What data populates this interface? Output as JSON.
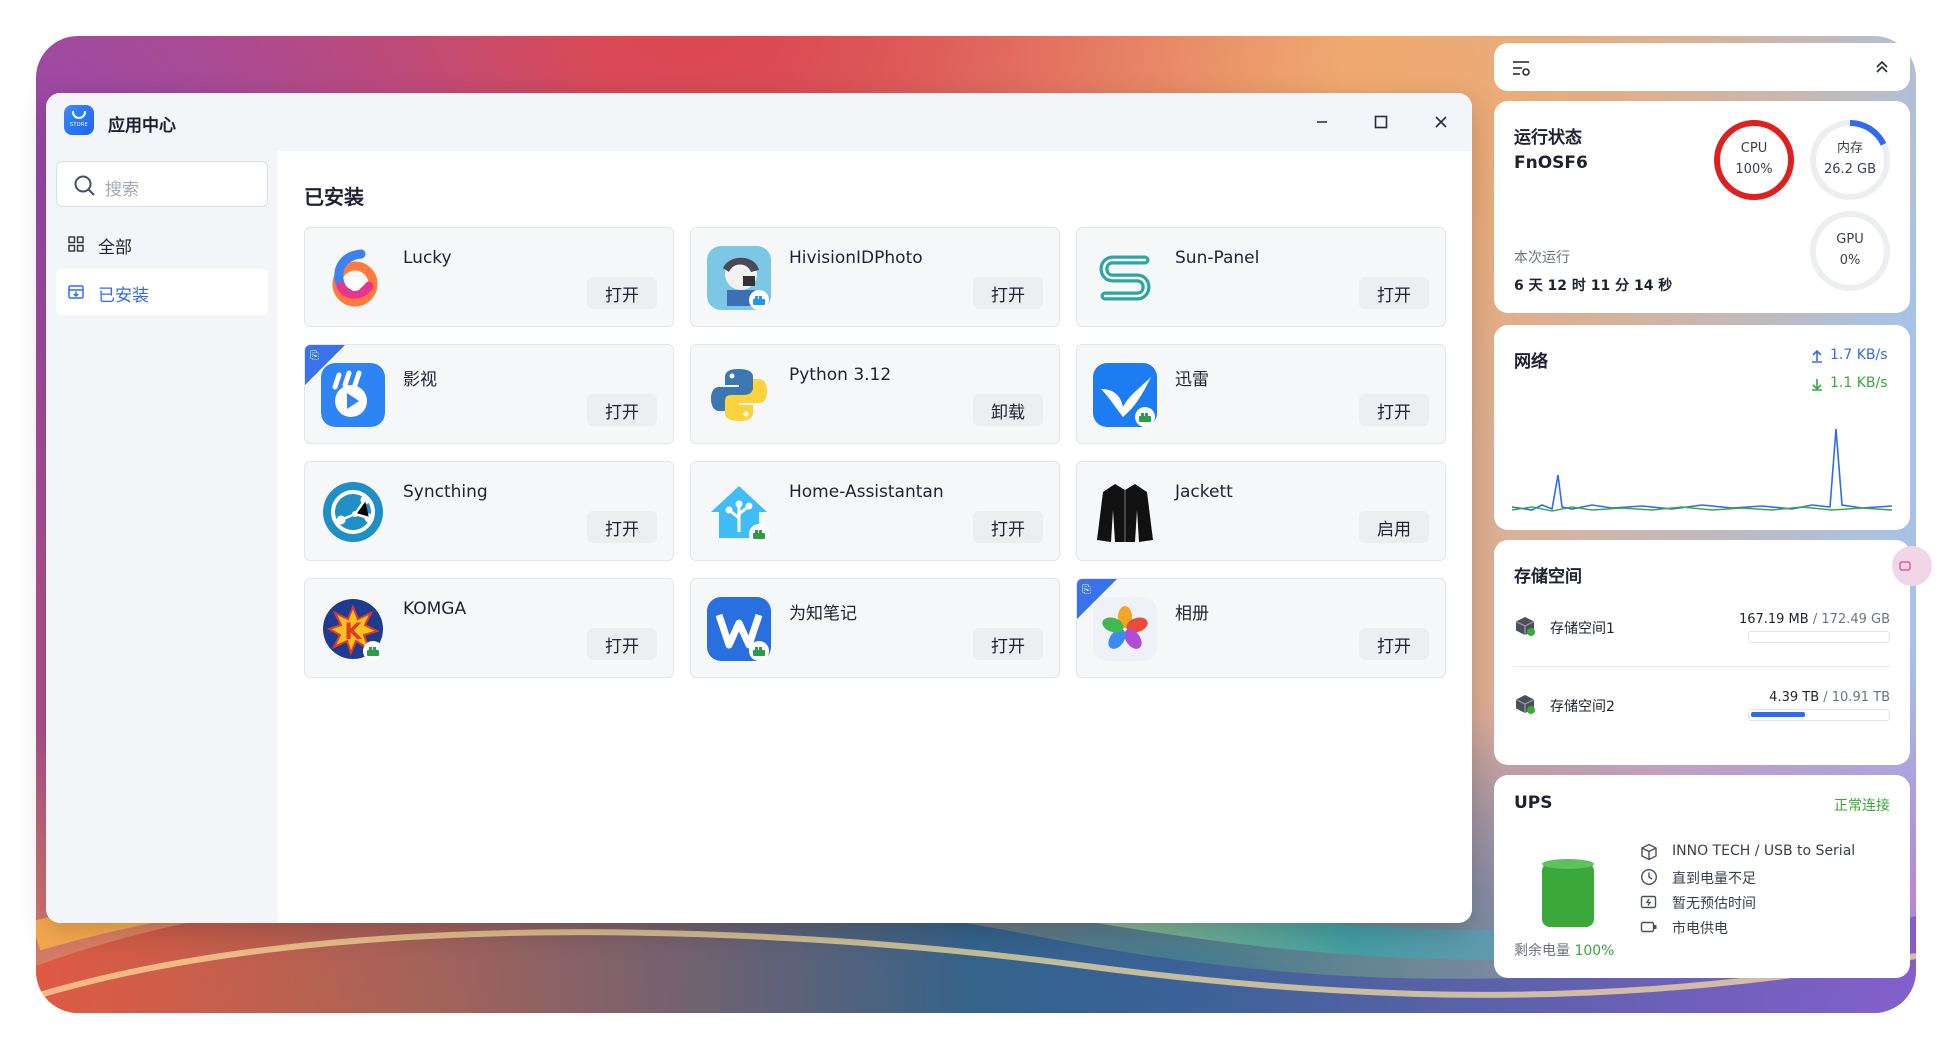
{
  "window": {
    "title": "应用中心",
    "logo_text": "STORE"
  },
  "sidebar": {
    "search_placeholder": "搜索",
    "items": [
      {
        "label": "全部"
      },
      {
        "label": "已安装"
      }
    ]
  },
  "main": {
    "section_title": "已安装",
    "apps": [
      {
        "name": "Lucky",
        "action": "打开"
      },
      {
        "name": "HivisionIDPhoto",
        "action": "打开"
      },
      {
        "name": "Sun-Panel",
        "action": "打开"
      },
      {
        "name": "影视",
        "action": "打开"
      },
      {
        "name": "Python 3.12",
        "action": "卸载"
      },
      {
        "name": "迅雷",
        "action": "打开"
      },
      {
        "name": "Syncthing",
        "action": "打开"
      },
      {
        "name": "Home-Assistantan",
        "action": "打开"
      },
      {
        "name": "Jackett",
        "action": "启用"
      },
      {
        "name": "KOMGA",
        "action": "打开"
      },
      {
        "name": "为知笔记",
        "action": "打开"
      },
      {
        "name": "相册",
        "action": "打开"
      }
    ]
  },
  "status": {
    "title": "运行状态",
    "host": "FnOSF6",
    "cpu_label": "CPU",
    "cpu_value": "100%",
    "cpu_level": 1.0,
    "mem_label": "内存",
    "mem_value": "26.2 GB",
    "mem_level": 0.18,
    "gpu_label": "GPU",
    "gpu_value": "0%",
    "uptime_label": "本次运行",
    "uptime_value": "6 天 12 时 11 分 14 秒"
  },
  "network": {
    "title": "网络",
    "upload": "1.7 KB/s",
    "download": "1.1 KB/s"
  },
  "storage": {
    "title": "存储空间",
    "volumes": [
      {
        "name": "存储空间1",
        "used": "167.19 MB",
        "sep": "/",
        "total": "172.49 GB",
        "fraction": 0.001
      },
      {
        "name": "存储空间2",
        "used": "4.39 TB",
        "sep": "/",
        "total": "10.91 TB",
        "fraction": 0.4
      }
    ]
  },
  "ups": {
    "title": "UPS",
    "status": "正常连接",
    "battery_label": "剩余电量",
    "battery_value": "100%",
    "details": [
      {
        "text": "INNO TECH / USB to Serial"
      },
      {
        "text": "直到电量不足"
      },
      {
        "text": "暂无预估时间"
      },
      {
        "text": "市电供电"
      }
    ]
  },
  "colors": {
    "accent": "#2f6bf0",
    "cpu_ring": "#e0201e",
    "ok_green": "#3aa83a"
  }
}
